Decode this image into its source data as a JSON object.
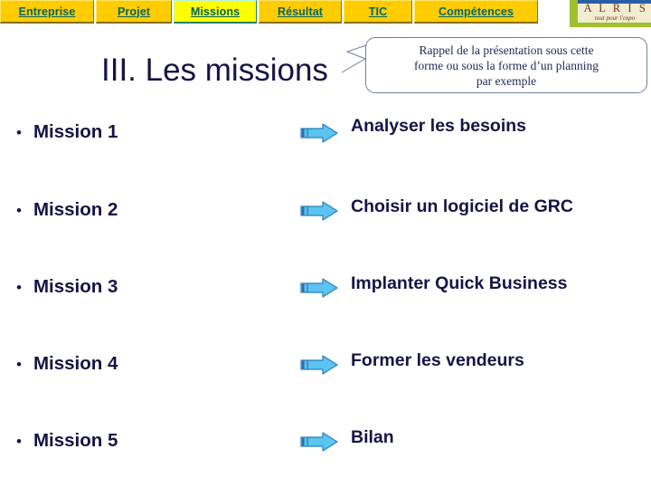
{
  "navbar": {
    "tabs": [
      {
        "label": "Entreprise",
        "active": false
      },
      {
        "label": "Projet",
        "active": false
      },
      {
        "label": "Missions",
        "active": true
      },
      {
        "label": "Résultat",
        "active": false
      },
      {
        "label": "TIC",
        "active": false
      },
      {
        "label": "Compétences",
        "active": false
      }
    ],
    "tab_color": "#FFCC00",
    "active_tab_color": "#FFFF00",
    "label_color": "#006666"
  },
  "logo": {
    "name": "A L R I S",
    "tagline": "tout pour l'expo",
    "accent_green": "#9FBF2F",
    "accent_blue": "#2B5EA8",
    "background": "#F2EDD0",
    "text_color": "#7a3218"
  },
  "title": {
    "text": "III. Les missions",
    "color": "#141446"
  },
  "callout": {
    "line1": "Rappel de la présentation sous cette",
    "line2": "forme ou sous la forme d’un planning",
    "line3": "par exemple",
    "border_color": "#6f7fa0",
    "text_color": "#1b2a55"
  },
  "arrow": {
    "fill": "#5BC4F1",
    "stroke": "#2B7FB8",
    "tail_fill": "#3D8FBF"
  },
  "rows": [
    {
      "bullet": "•",
      "left_label": "Mission 1",
      "right_label": "Analyser les besoins"
    },
    {
      "bullet": "•",
      "left_label": "Mission 2",
      "right_label": "Choisir un logiciel de GRC"
    },
    {
      "bullet": "•",
      "left_label": "Mission 3",
      "right_label": "Implanter Quick Business"
    },
    {
      "bullet": "•",
      "left_label": "Mission 4",
      "right_label": "Former les vendeurs"
    },
    {
      "bullet": "•",
      "left_label": "Mission 5",
      "right_label": "Bilan"
    }
  ]
}
